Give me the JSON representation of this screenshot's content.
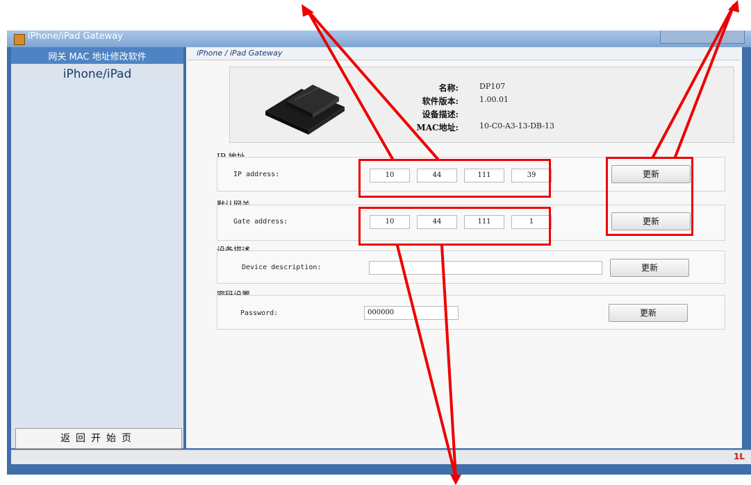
{
  "window": {
    "title": "iPhone/iPad Gateway"
  },
  "sidebar": {
    "header": "网关 MAC 地址修改软件",
    "subtitle": "iPhone/iPad",
    "home_button": "返回开始页"
  },
  "content": {
    "breadcrumb": "iPhone / iPad Gateway"
  },
  "device_info": {
    "name_label": "名称:",
    "name_value": "DP107",
    "version_label": "软件版本:",
    "version_value": "1.00.01",
    "description_label": "设备描述:",
    "description_value": "",
    "mac_label": "MAC地址:",
    "mac_value": "10-C0-A3-13-DB-13"
  },
  "ip_group": {
    "title": "IP 地址",
    "label": "IP address:",
    "octets": [
      "10",
      "44",
      "111",
      "39"
    ],
    "button": "更新"
  },
  "gateway_group": {
    "title": "默认网关",
    "label": "Gate address:",
    "octets": [
      "10",
      "44",
      "111",
      "1"
    ],
    "button": "更新"
  },
  "desc_group": {
    "title": "设备描述",
    "label": "Device description:",
    "value": "",
    "button": "更新"
  },
  "password_group": {
    "title": "密码设置",
    "label": "Password:",
    "value": "000000",
    "button": "更新"
  },
  "colors": {
    "accent": "#4e84c4",
    "annotation": "#ee0000",
    "status_icon": "#d01818"
  },
  "icons": {
    "app": "gateway-app-icon",
    "status": "status-logo-icon"
  }
}
